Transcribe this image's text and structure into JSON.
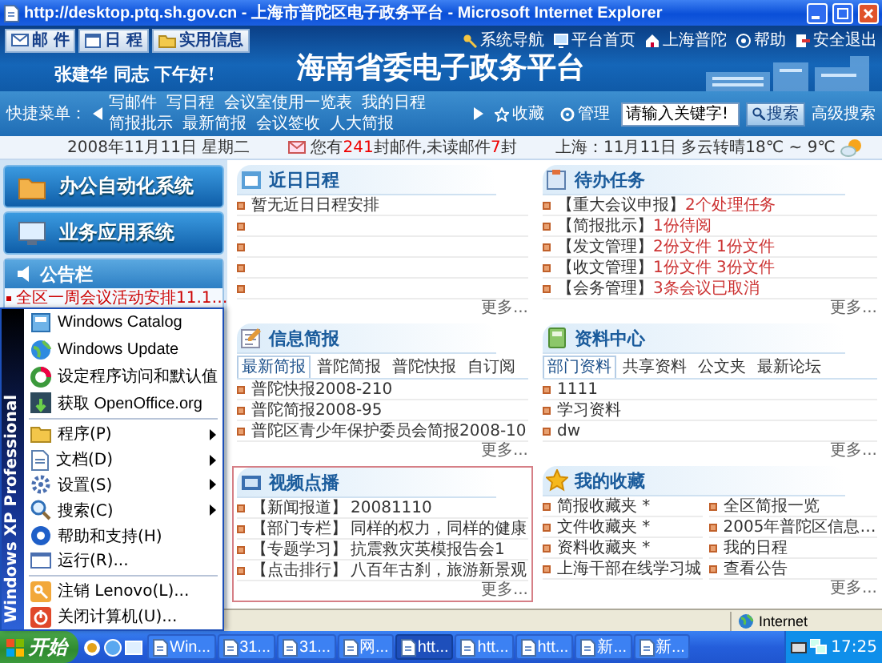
{
  "window": {
    "title": "http://desktop.ptq.sh.gov.cn - 上海市普陀区电子政务平台 - Microsoft Internet Explorer"
  },
  "banner": {
    "tool_buttons": [
      "邮 件",
      "日 程",
      "实用信息"
    ],
    "nav_links": [
      "系统导航",
      "平台首页",
      "上海普陀",
      "帮助",
      "安全退出"
    ],
    "title": "海南省委电子政务平台",
    "greeting": "张建华  同志  下午好!"
  },
  "quick_menu": {
    "label": "快捷菜单：",
    "items": [
      "写邮件",
      "写日程",
      "会议室使用一览表",
      "我的日程",
      "简报批示",
      "最新简报",
      "会议签收",
      "人大简报"
    ],
    "links": [
      "收藏",
      "管理"
    ],
    "search": {
      "value": "请输入关键字!"
    },
    "search_button": "搜索",
    "advanced": "高级搜索"
  },
  "info_bar": {
    "date": "2008年11月11日  星期二",
    "mail_notice": [
      {
        "text": "您有",
        "highlight": false
      },
      {
        "text": "241",
        "highlight": true
      },
      {
        "text": "封邮件,未读邮件",
        "highlight": false
      },
      {
        "text": "7",
        "highlight": true
      },
      {
        "text": "封",
        "highlight": false
      }
    ],
    "weather": "上海：11月11日  多云转晴18℃ ~ 9℃"
  },
  "left": {
    "systems": [
      "办公自动化系统",
      "业务应用系统"
    ],
    "notice_board": {
      "title": "公告栏",
      "items": [
        "全区一周会议活动安排11.1…"
      ]
    }
  },
  "center_panels": [
    {
      "kind": "list",
      "title": "近日日程",
      "items": [
        "暂无近日日程安排"
      ],
      "more": "更多..."
    },
    {
      "kind": "tabs",
      "title": "信息简报",
      "tabs": [
        {
          "label": "最新简报",
          "selected": true
        },
        {
          "label": "普陀简报",
          "selected": false
        },
        {
          "label": "普陀快报",
          "selected": false
        },
        {
          "label": "自订阅",
          "selected": false
        }
      ],
      "items": [
        "普陀快报2008-210",
        "普陀简报2008-95",
        "普陀区青少年保护委员会简报2008-10"
      ],
      "more": "更多..."
    },
    {
      "kind": "video",
      "title": "视频点播",
      "items": [
        {
          "category": "【新闻报道】",
          "title": "20081110"
        },
        {
          "category": "【部门专栏】",
          "title": "同样的权力，同样的健康"
        },
        {
          "category": "【专题学习】",
          "title": "抗震救灾英模报告会1"
        },
        {
          "category": "【点击排行】",
          "title": "八百年古刹，旅游新景观"
        }
      ],
      "more": "更多..."
    }
  ],
  "right_panels": [
    {
      "kind": "tasks",
      "title": "待办任务",
      "items": [
        {
          "category": "【重大会议申报】",
          "detail": "2个处理任务"
        },
        {
          "category": "【简报批示】",
          "detail": "1份待阅"
        },
        {
          "category": "【发文管理】",
          "detail": "2份文件  1份文件"
        },
        {
          "category": "【收文管理】",
          "detail": "1份文件  3份文件"
        },
        {
          "category": "【会务管理】",
          "detail": "3条会议已取消"
        }
      ],
      "more": "更多..."
    },
    {
      "kind": "tabs",
      "title": "资料中心",
      "tabs": [
        {
          "label": "部门资料",
          "selected": true
        },
        {
          "label": "共享资料",
          "selected": false
        },
        {
          "label": "公文夹",
          "selected": false
        },
        {
          "label": "最新论坛",
          "selected": false
        }
      ],
      "items": [
        "1111",
        "学习资料",
        "dw"
      ],
      "more": "更多..."
    },
    {
      "kind": "grid",
      "title": "我的收藏",
      "items": [
        "简报收藏夹 *",
        "全区简报一览",
        "文件收藏夹 *",
        "2005年普陀区信息…",
        "资料收藏夹 *",
        "我的日程",
        "上海干部在线学习城",
        "查看公告"
      ],
      "more": "更多..."
    }
  ],
  "start_menu": {
    "strip": "Windows XP Professional",
    "pinned": [
      "Windows Catalog",
      "Windows Update",
      "设定程序访问和默认值",
      "获取 OpenOffice.org"
    ],
    "items": [
      {
        "label": "程序(P)",
        "submenu": true
      },
      {
        "label": "文档(D)",
        "submenu": true
      },
      {
        "label": "设置(S)",
        "submenu": true
      },
      {
        "label": "搜索(C)",
        "submenu": true
      },
      {
        "label": "帮助和支持(H)",
        "submenu": false
      },
      {
        "label": "运行(R)...",
        "submenu": false
      }
    ],
    "session": [
      "注销 Lenovo(L)...",
      "关闭计算机(U)..."
    ]
  },
  "status_bar": {
    "zone": "Internet"
  },
  "taskbar": {
    "start": "开始",
    "tasks": [
      {
        "label": "Win...",
        "selected": false
      },
      {
        "label": "31...",
        "selected": false
      },
      {
        "label": "31...",
        "selected": false
      },
      {
        "label": "网...",
        "selected": false
      },
      {
        "label": "htt...",
        "selected": true
      },
      {
        "label": "htt...",
        "selected": false
      },
      {
        "label": "htt...",
        "selected": false
      },
      {
        "label": "新...",
        "selected": false
      },
      {
        "label": "新...",
        "selected": false
      }
    ],
    "clock": "17:25"
  }
}
